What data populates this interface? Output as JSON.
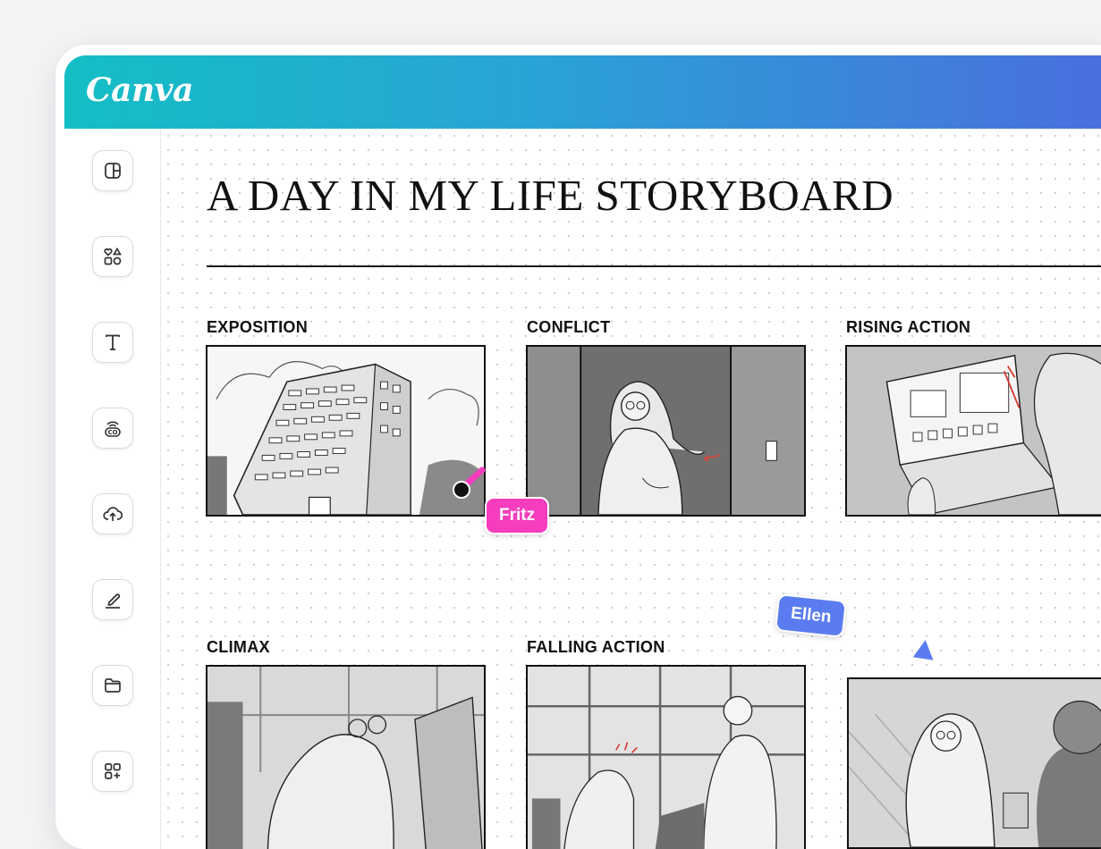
{
  "app": {
    "logo_text": "Canva"
  },
  "sidebar": {
    "items": [
      {
        "icon": "design-layout-icon"
      },
      {
        "icon": "elements-shapes-icon"
      },
      {
        "icon": "text-icon"
      },
      {
        "icon": "brand-co-icon"
      },
      {
        "icon": "cloud-upload-icon"
      },
      {
        "icon": "draw-pen-icon"
      },
      {
        "icon": "folder-icon"
      },
      {
        "icon": "apps-add-icon"
      }
    ]
  },
  "document": {
    "title": "A DAY IN MY LIFE STORYBOARD",
    "frames": [
      {
        "label": "EXPOSITION"
      },
      {
        "label": "CONFLICT"
      },
      {
        "label": "RISING ACTION"
      },
      {
        "label": "CLIMAX"
      },
      {
        "label": "FALLING ACTION"
      },
      {
        "label": ""
      }
    ]
  },
  "collaborators": [
    {
      "name": "Fritz",
      "color": "#f53dbd"
    },
    {
      "name": "Ellen",
      "color": "#5b7cf0"
    }
  ]
}
